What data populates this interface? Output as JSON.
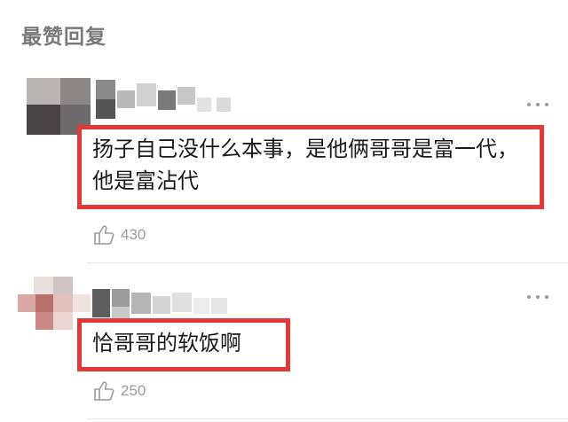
{
  "section": {
    "title": "最赞回复"
  },
  "comments": [
    {
      "text": "扬子自己没什么本事，是他俩哥哥是富一代，他是富沾代",
      "likes": "430",
      "like_icon": "thumbs-up-icon",
      "more_icon": "more-dots-icon"
    },
    {
      "text": "恰哥哥的软饭啊",
      "likes": "250",
      "like_icon": "thumbs-up-icon",
      "more_icon": "more-dots-icon"
    }
  ],
  "colors": {
    "highlight_border": "#e13838",
    "muted_text": "#9a9a9a",
    "body_text": "#1a1a1a"
  }
}
